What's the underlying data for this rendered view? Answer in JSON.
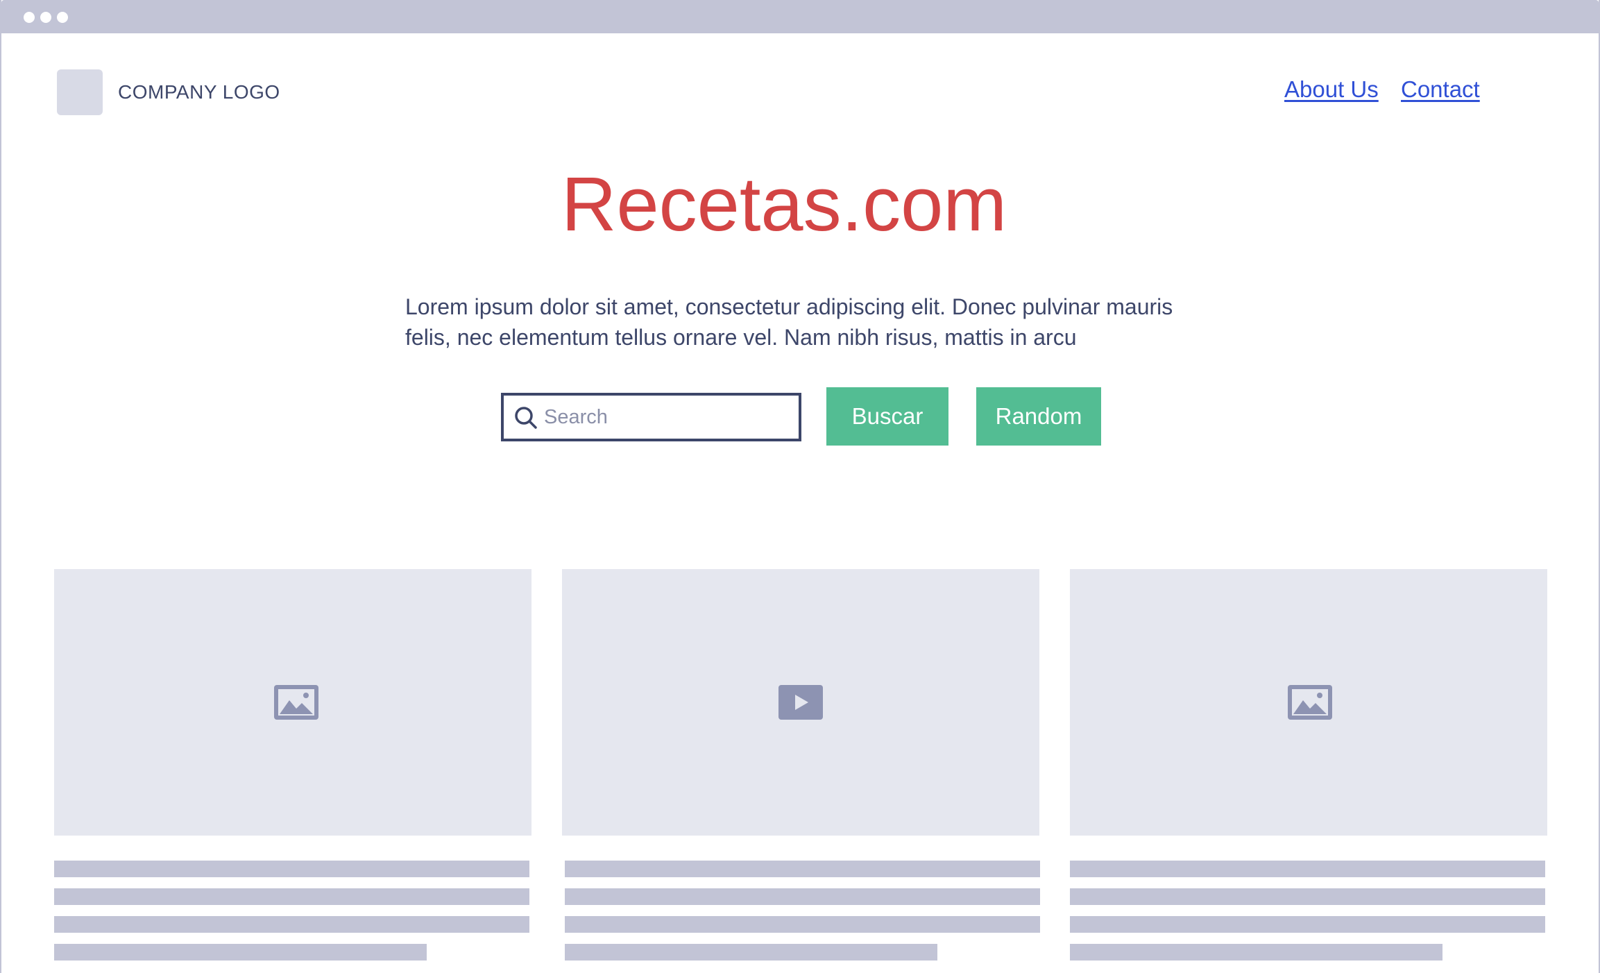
{
  "window": {
    "controls": [
      "close",
      "minimize",
      "maximize"
    ]
  },
  "header": {
    "logo_text": "COMPANY LOGO",
    "nav": {
      "about": "About Us",
      "contact": "Contact"
    }
  },
  "hero": {
    "title": "Recetas.com",
    "description": "Lorem ipsum dolor sit amet, consectetur adipiscing elit. Donec pulvinar mauris felis, nec elementum tellus ornare vel. Nam nibh risus, mattis in arcu"
  },
  "search": {
    "placeholder": "Search",
    "value": "",
    "icon": "search-icon"
  },
  "actions": {
    "search_label": "Buscar",
    "random_label": "Random"
  },
  "cards": [
    {
      "media": "image-icon"
    },
    {
      "media": "video-play-icon"
    },
    {
      "media": "image-icon"
    }
  ],
  "colors": {
    "title": "#d34444",
    "button": "#53bd93",
    "link": "#3050d6",
    "placeholder": "#e5e7ef",
    "text_line": "#c2c4d6"
  }
}
